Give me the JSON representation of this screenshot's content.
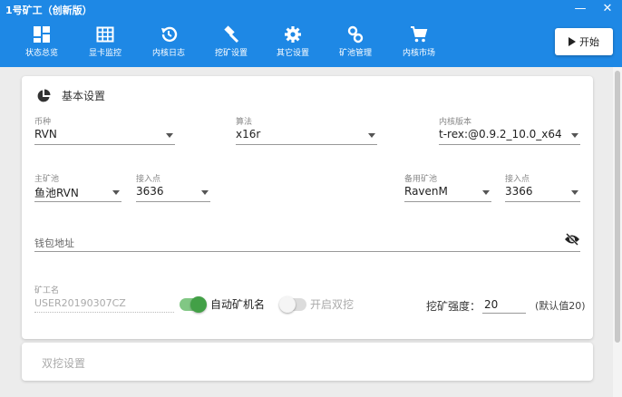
{
  "window": {
    "title": "1号矿工（创新版）",
    "minimize_glyph": "—",
    "close_glyph": "✕"
  },
  "nav": [
    {
      "label": "状态总览",
      "icon": "dashboard-icon"
    },
    {
      "label": "显卡监控",
      "icon": "grid-icon"
    },
    {
      "label": "内核日志",
      "icon": "history-icon"
    },
    {
      "label": "挖矿设置",
      "icon": "hammer-icon"
    },
    {
      "label": "其它设置",
      "icon": "gear-icon"
    },
    {
      "label": "矿池管理",
      "icon": "link-icon"
    },
    {
      "label": "内核市场",
      "icon": "cart-icon"
    }
  ],
  "start_button": {
    "label": "开始",
    "icon": "play-icon"
  },
  "basic": {
    "title": "基本设置",
    "coin": {
      "label": "币种",
      "value": "RVN"
    },
    "algo": {
      "label": "算法",
      "value": "x16r"
    },
    "kernel": {
      "label": "内核版本",
      "value": "t-rex:@0.9.2_10.0_x64"
    },
    "main_pool": {
      "label": "主矿池",
      "value": "鱼池RVN"
    },
    "main_port": {
      "label": "接入点",
      "value": "3636"
    },
    "backup_pool": {
      "label": "备用矿池",
      "value": "RavenM"
    },
    "backup_port": {
      "label": "接入点",
      "value": "3366"
    },
    "wallet": {
      "placeholder": "钱包地址",
      "visibility_icon": "eye-off-icon"
    },
    "miner": {
      "label": "矿工名",
      "value": "USER20190307CZ"
    },
    "auto_miner_name": {
      "label": "自动矿机名",
      "on": true
    },
    "dual_mining": {
      "label": "开启双挖",
      "on": false
    },
    "intensity": {
      "label": "挖矿强度：",
      "value": "20",
      "default_text": "(默认值20)"
    }
  },
  "dual_settings": {
    "title": "双挖设置"
  },
  "colors": {
    "primary": "#1e88e5",
    "toggle_on": "#43a047"
  }
}
